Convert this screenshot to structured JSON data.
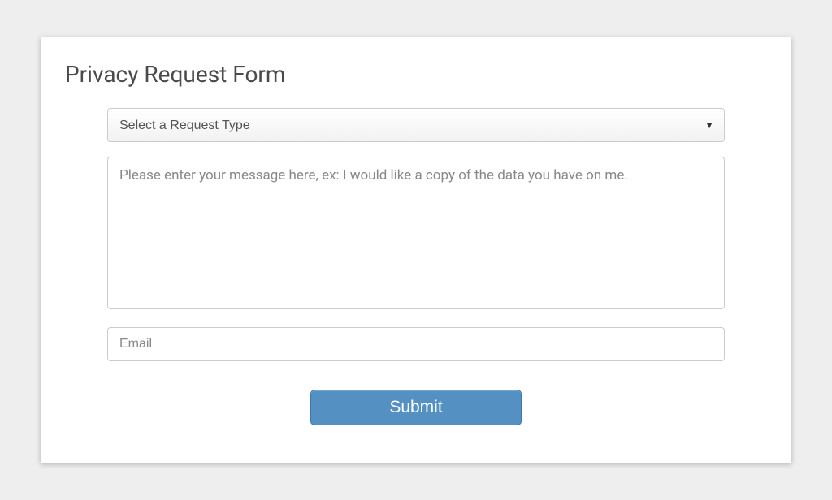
{
  "form": {
    "title": "Privacy Request Form",
    "request_type": {
      "placeholder": "Select a Request Type"
    },
    "message": {
      "placeholder": "Please enter your message here, ex: I would like a copy of the data you have on me."
    },
    "email": {
      "placeholder": "Email"
    },
    "submit_label": "Submit"
  }
}
